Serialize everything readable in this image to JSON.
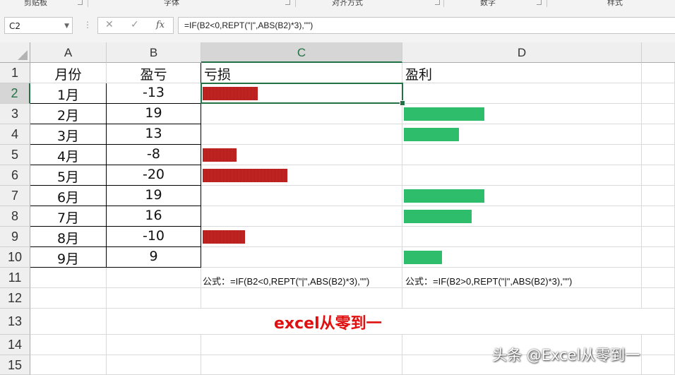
{
  "ribbon": {
    "groups": [
      "剪贴板",
      "字体",
      "对齐方式",
      "数字",
      "样式"
    ]
  },
  "formula_bar": {
    "name_box": "C2",
    "cancel_icon": "✕",
    "enter_icon": "✓",
    "fx_label": "fx",
    "formula": "=IF(B2<0,REPT(\"|\",ABS(B2)*3),\"\")"
  },
  "columns": [
    "A",
    "B",
    "C",
    "D"
  ],
  "rows": [
    "1",
    "2",
    "3",
    "4",
    "5",
    "6",
    "7",
    "8",
    "9",
    "10",
    "11",
    "12",
    "13",
    "14",
    "15"
  ],
  "table": {
    "header_month": "月份",
    "header_value": "盈亏",
    "header_loss": "亏损",
    "header_profit": "盈利",
    "records": [
      {
        "month": "1月",
        "value": "-13",
        "num": -13
      },
      {
        "month": "2月",
        "value": "19",
        "num": 19
      },
      {
        "month": "3月",
        "value": "13",
        "num": 13
      },
      {
        "month": "4月",
        "value": "-8",
        "num": -8
      },
      {
        "month": "5月",
        "value": "-20",
        "num": -20
      },
      {
        "month": "6月",
        "value": "19",
        "num": 19
      },
      {
        "month": "7月",
        "value": "16",
        "num": 16
      },
      {
        "month": "8月",
        "value": "-10",
        "num": -10
      },
      {
        "month": "9月",
        "value": "9",
        "num": 9
      }
    ]
  },
  "notes": {
    "loss_formula": "公式：=IF(B2<0,REPT(\"|\",ABS(B2)*3),\"\")",
    "profit_formula": "公式：=IF(B2>0,REPT(\"|\",ABS(B2)*3),\"\")"
  },
  "banner": "excel从零到一",
  "watermark": "头条 @Excel从零到一",
  "colors": {
    "loss_bar": "#d9211f",
    "profit_bar": "#2ebd6b",
    "selection": "#217346",
    "banner": "#e01010"
  }
}
